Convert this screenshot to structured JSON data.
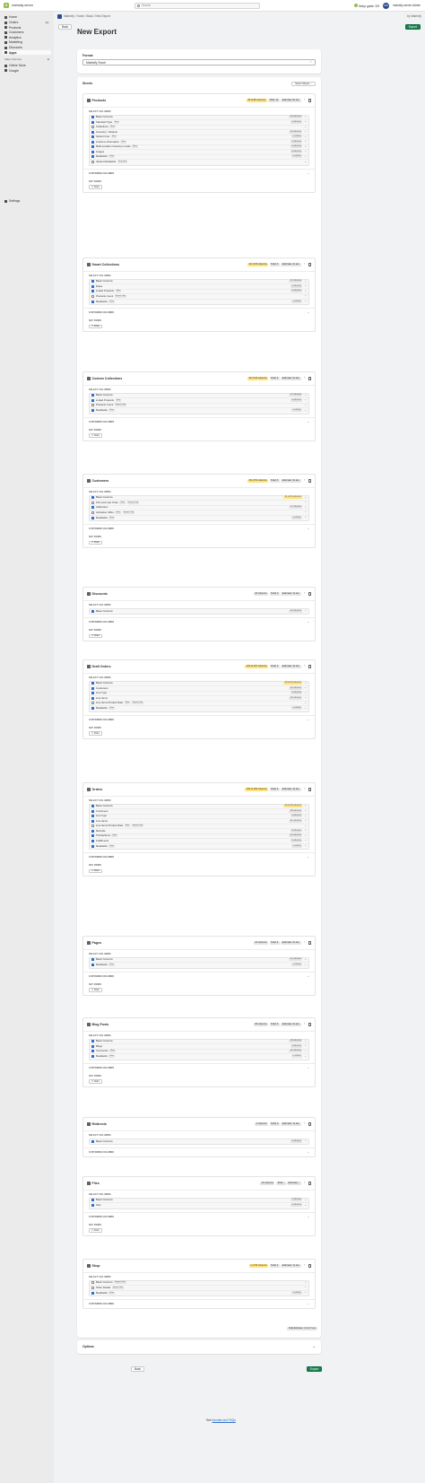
{
  "topbar": {
    "store": "mainstly-seven",
    "search_placeholder": "Search",
    "guide": "Setup guide: 3/5",
    "user": "mainstly-seven Admin",
    "avatar": "MS"
  },
  "nav": {
    "items": [
      "Home",
      "Orders",
      "Products",
      "Customers",
      "Analytics",
      "Marketing",
      "Discounts",
      "Apps"
    ],
    "orders_badge": "12",
    "section": "Sales channels",
    "channels": [
      "Online Store",
      "Google"
    ],
    "settings": "Settings"
  },
  "appbar": {
    "crumb": "Matrixify / Home / Back / New Export",
    "by": "by Matrixify"
  },
  "actions": {
    "back": "Back",
    "export": "Export"
  },
  "title": "New Export",
  "format": {
    "label": "Format",
    "value": "Matrixify Excel"
  },
  "sheets_card": {
    "label": "Sheets",
    "select_sheets": "Select Sheets"
  },
  "labels": {
    "select_columns": "SELECT COLUMNS",
    "customize_columns": "CUSTOMIZE COLUMNS",
    "set_rows": "SET ROWS",
    "filter": "Filter"
  },
  "sheets": [
    {
      "name": "Products",
      "columns_pill": "45 of 86 columns",
      "total": "Total: 14",
      "estimate": "Estimate: 8s est.",
      "warn": true,
      "has_filter": true,
      "columns": [
        {
          "name": "Basic Columns",
          "on": true,
          "count": "24 columns",
          "warn": false
        },
        {
          "name": "Standard Type",
          "on": true,
          "tag": "Slow",
          "count": "2 columns",
          "warn": false
        },
        {
          "name": "Collections",
          "on": false,
          "tag": "Slow",
          "count": "",
          "warn": false
        },
        {
          "name": "Inventory / Variants",
          "on": true,
          "count": "34 columns",
          "warn": false
        },
        {
          "name": "Variant Cost",
          "on": true,
          "tag": "Slow",
          "count": "1 column",
          "warn": false
        },
        {
          "name": "Customs Information",
          "on": true,
          "tag": "Slow",
          "count": "2 columns",
          "warn": false
        },
        {
          "name": "Multi-Location Inventory Levels",
          "on": true,
          "tag": "Slow",
          "count": "2 columns",
          "warn": false
        },
        {
          "name": "Images",
          "on": true,
          "count": "8 columns",
          "warn": false
        },
        {
          "name": "Metafields",
          "on": true,
          "tag": "Slow",
          "count": "1 column",
          "warn": false
        },
        {
          "name": "Variant Metafields",
          "on": false,
          "tag": "Very Slow",
          "count": "",
          "warn": false
        }
      ]
    },
    {
      "name": "Smart Collections",
      "columns_pill": "22 of 26 columns",
      "total": "Total: 3",
      "estimate": "Estimate: 2s est.",
      "warn": true,
      "has_filter": true,
      "columns": [
        {
          "name": "Basic Columns",
          "on": true,
          "count": "17 columns",
          "warn": false
        },
        {
          "name": "Rules",
          "on": true,
          "count": "4 columns",
          "warn": false
        },
        {
          "name": "Linked Products",
          "on": true,
          "tag": "Slow",
          "count": "3 columns",
          "warn": false
        },
        {
          "name": "Products Count",
          "on": false,
          "tag": "Export Only",
          "count": "",
          "warn": false
        },
        {
          "name": "Metafields",
          "on": true,
          "tag": "Slow",
          "count": "1 column",
          "warn": false
        }
      ]
    },
    {
      "name": "Custom Collections",
      "columns_pill": "22 of 23 columns",
      "total": "Total: 6",
      "estimate": "Estimate: 2s est.",
      "warn": true,
      "has_filter": true,
      "columns": [
        {
          "name": "Basic Columns",
          "on": true,
          "count": "17 columns",
          "warn": false
        },
        {
          "name": "Linked Products",
          "on": true,
          "tag": "Slow",
          "count": "4 columns",
          "warn": false
        },
        {
          "name": "Products Count",
          "on": false,
          "tag": "Export Only",
          "count": "",
          "warn": false
        },
        {
          "name": "Metafields",
          "on": true,
          "tag": "Slow",
          "count": "1 column",
          "warn": false
        }
      ]
    },
    {
      "name": "Customers",
      "columns_pill": "49 of 51 columns",
      "total": "Total: 3",
      "estimate": "Estimate: 3s est.",
      "warn": true,
      "has_filter": true,
      "columns": [
        {
          "name": "Basic Columns",
          "on": true,
          "count": "31 of 33 columns",
          "warn": true
        },
        {
          "name": "First and Last Order",
          "on": false,
          "tag": "Slow",
          "tag2": "Export Only",
          "count": "",
          "warn": false
        },
        {
          "name": "Addresses",
          "on": true,
          "count": "17 columns",
          "warn": false
        },
        {
          "name": "Activation URLs",
          "on": false,
          "tag": "Slow",
          "tag2": "Export Only",
          "count": "",
          "warn": false
        },
        {
          "name": "Metafields",
          "on": true,
          "tag": "Slow",
          "count": "1 column",
          "warn": false
        }
      ]
    },
    {
      "name": "Discounts",
      "columns_pill": "22 columns",
      "total": "Total: 0",
      "estimate": "Estimate: 1s est.",
      "warn": false,
      "has_filter": true,
      "columns": [
        {
          "name": "Basic Columns",
          "on": true,
          "count": "22 columns",
          "warn": false
        }
      ]
    },
    {
      "name": "Draft Orders",
      "columns_pill": "104 of 107 columns",
      "total": "Total: 3",
      "estimate": "Estimate: 3s est.",
      "warn": true,
      "has_filter": true,
      "columns": [
        {
          "name": "Basic Columns",
          "on": true,
          "count": "38 of 40 columns",
          "warn": true
        },
        {
          "name": "Customers",
          "on": true,
          "count": "22 columns",
          "warn": false
        },
        {
          "name": "Line Type",
          "on": true,
          "count": "3 columns",
          "warn": false
        },
        {
          "name": "Line Items",
          "on": true,
          "count": "40 columns",
          "warn": false
        },
        {
          "name": "Line Items Product Data",
          "on": false,
          "tag": "Slow",
          "tag2": "Export Only",
          "count": "",
          "warn": false
        },
        {
          "name": "Metafields",
          "on": true,
          "tag": "Slow",
          "count": "1 column",
          "warn": false
        }
      ]
    },
    {
      "name": "Orders",
      "columns_pill": "160 of 166 columns",
      "total": "Total: 4",
      "estimate": "Estimate: 4s est.",
      "warn": true,
      "has_filter": true,
      "columns": [
        {
          "name": "Basic Columns",
          "on": true,
          "count": "40 of 46 columns",
          "warn": true
        },
        {
          "name": "Customers",
          "on": true,
          "count": "38 columns",
          "warn": false
        },
        {
          "name": "Line Type",
          "on": true,
          "count": "4 columns",
          "warn": false
        },
        {
          "name": "Line Items",
          "on": true,
          "count": "41 columns",
          "warn": false
        },
        {
          "name": "Line Items Product Data",
          "on": false,
          "tag": "Slow",
          "tag2": "Export Only",
          "count": "",
          "warn": false
        },
        {
          "name": "Refunds",
          "on": true,
          "count": "8 columns",
          "warn": false
        },
        {
          "name": "Transactions",
          "on": true,
          "tag": "Slow",
          "count": "22 columns",
          "warn": false
        },
        {
          "name": "Fulfillments",
          "on": true,
          "count": "6 columns",
          "warn": false
        },
        {
          "name": "Metafields",
          "on": true,
          "tag": "Slow",
          "count": "1 column",
          "warn": false
        }
      ]
    },
    {
      "name": "Pages",
      "columns_pill": "12 columns",
      "total": "Total: 4",
      "estimate": "Estimate: 2s est.",
      "warn": false,
      "has_filter": true,
      "columns": [
        {
          "name": "Basic Columns",
          "on": true,
          "count": "11 columns",
          "warn": false
        },
        {
          "name": "Metafields",
          "on": true,
          "tag": "Slow",
          "count": "1 column",
          "warn": false
        }
      ]
    },
    {
      "name": "Blog Posts",
      "columns_pill": "36 columns",
      "total": "Total: 3",
      "estimate": "Estimate: 2s est.",
      "warn": false,
      "has_filter": true,
      "columns": [
        {
          "name": "Basic Columns",
          "on": true,
          "count": "19 columns",
          "warn": false
        },
        {
          "name": "Blogs",
          "on": true,
          "count": "4 columns",
          "warn": false
        },
        {
          "name": "Comments",
          "on": true,
          "tag": "Slow",
          "count": "12 columns",
          "warn": false
        },
        {
          "name": "Metafields",
          "on": true,
          "tag": "Slow",
          "count": "1 column",
          "warn": false
        }
      ]
    },
    {
      "name": "Redirects",
      "columns_pill": "4 columns",
      "total": "Total: 0",
      "estimate": "Estimate: 1s est.",
      "warn": false,
      "has_filter": false,
      "columns": [
        {
          "name": "Basic Columns",
          "on": true,
          "count": "4 columns",
          "warn": false
        }
      ]
    },
    {
      "name": "Files",
      "columns_pill": "11 columns",
      "total": "Total: -",
      "estimate": "Estimate: -",
      "warn": false,
      "has_filter": true,
      "columns": [
        {
          "name": "Basic Columns",
          "on": true,
          "count": "7 columns",
          "warn": false
        },
        {
          "name": "Size",
          "on": true,
          "count": "4 columns",
          "warn": false
        }
      ]
    },
    {
      "name": "Shop",
      "columns_pill": "1 of 46 columns",
      "total": "Total: 1",
      "estimate": "Estimate: 1s est.",
      "warn": true,
      "has_filter": false,
      "columns": [
        {
          "name": "Basic Columns",
          "on": false,
          "tag": "Export Only",
          "count": "",
          "warn": false
        },
        {
          "name": "Other Details",
          "on": false,
          "tag": "Export Only",
          "count": "",
          "warn": false
        },
        {
          "name": "Metafields",
          "on": true,
          "tag": "Slow",
          "count": "1 column",
          "warn": false
        }
      ]
    }
  ],
  "total_estimate": "Total Estimate: 1 min 17 sec",
  "options": {
    "label": "Options"
  },
  "footer": {
    "prefix": "See",
    "link": "tutorials and FAQs"
  }
}
